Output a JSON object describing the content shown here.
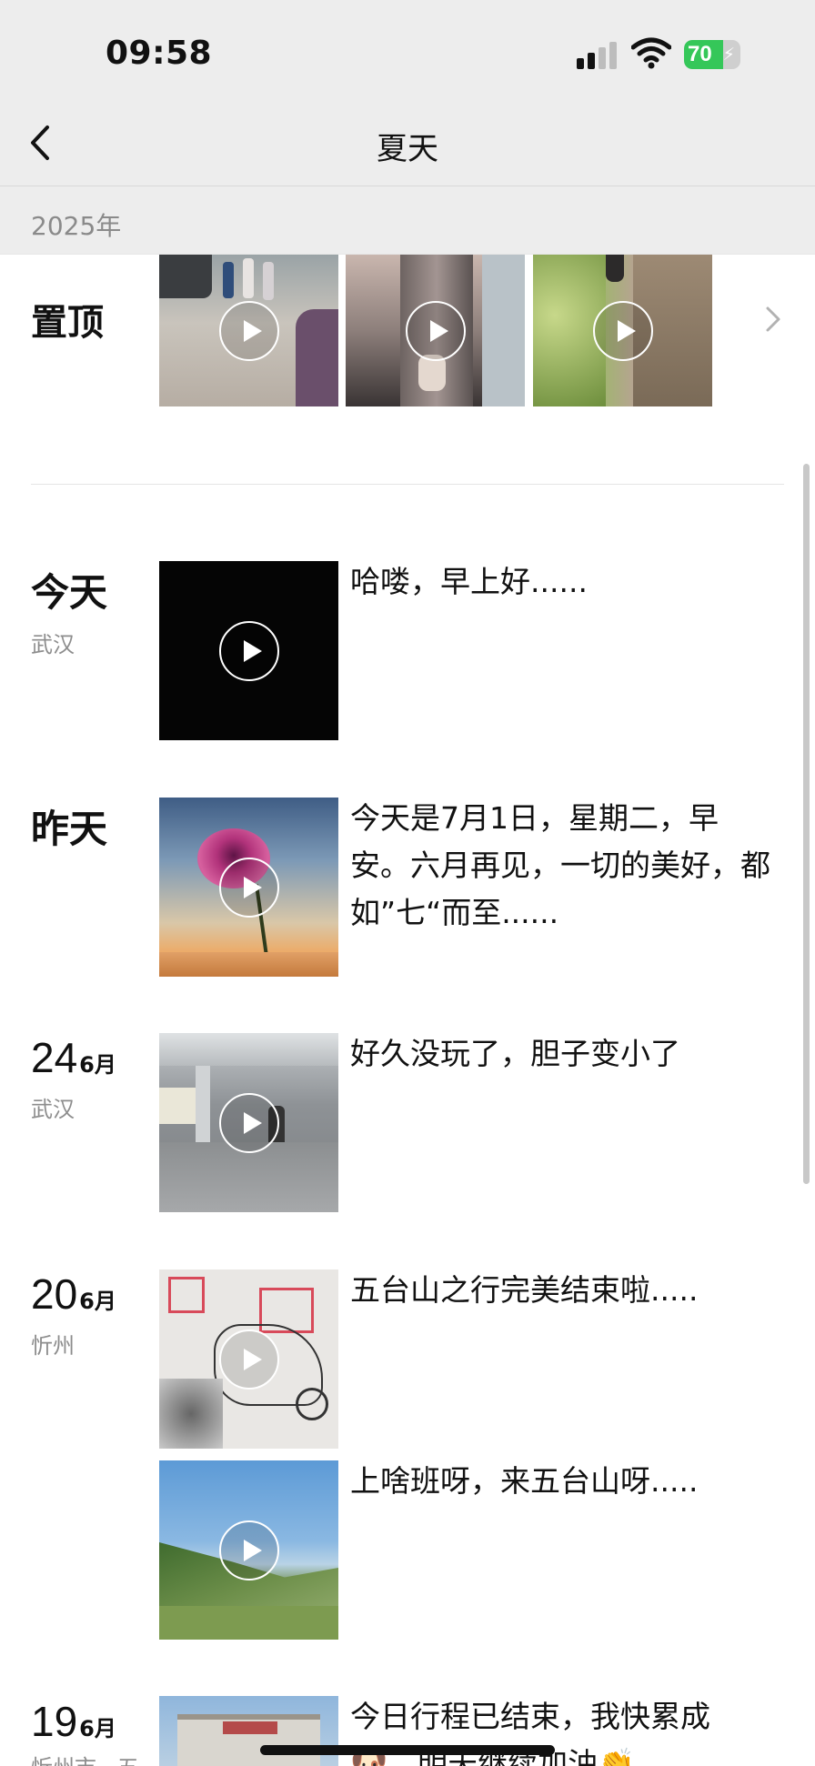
{
  "status": {
    "time": "09:58",
    "battery": "70",
    "battery_level": 0.7
  },
  "nav": {
    "title": "夏天",
    "back_icon": "chevron-left-icon"
  },
  "year": "2025年",
  "pinned": {
    "label": "置顶",
    "more_icon": "chevron-right-icon"
  },
  "entries": [
    {
      "big": "今天",
      "place": "武汉",
      "caption": "哈喽，早上好......"
    },
    {
      "big": "昨天",
      "caption": "今天是7月1日，星期二，早安。六月再见，一切的美好，都如”七“而至......"
    },
    {
      "day": "24",
      "month": "6月",
      "place": "武汉",
      "caption": "好久没玩了，胆子变小了"
    },
    {
      "day": "20",
      "month": "6月",
      "place": "忻州",
      "caption": "五台山之行完美结束啦.....",
      "caption2": "上啥班呀，来五台山呀....."
    },
    {
      "day": "19",
      "month": "6月",
      "place": "忻州市 · 五",
      "caption": "今日行程已结束，我快累成🐶，明天继续加油👏"
    }
  ],
  "colors": {
    "header_bg": "#ededed",
    "battery_green": "#35c759",
    "secondary_text": "#8d8d8d"
  }
}
